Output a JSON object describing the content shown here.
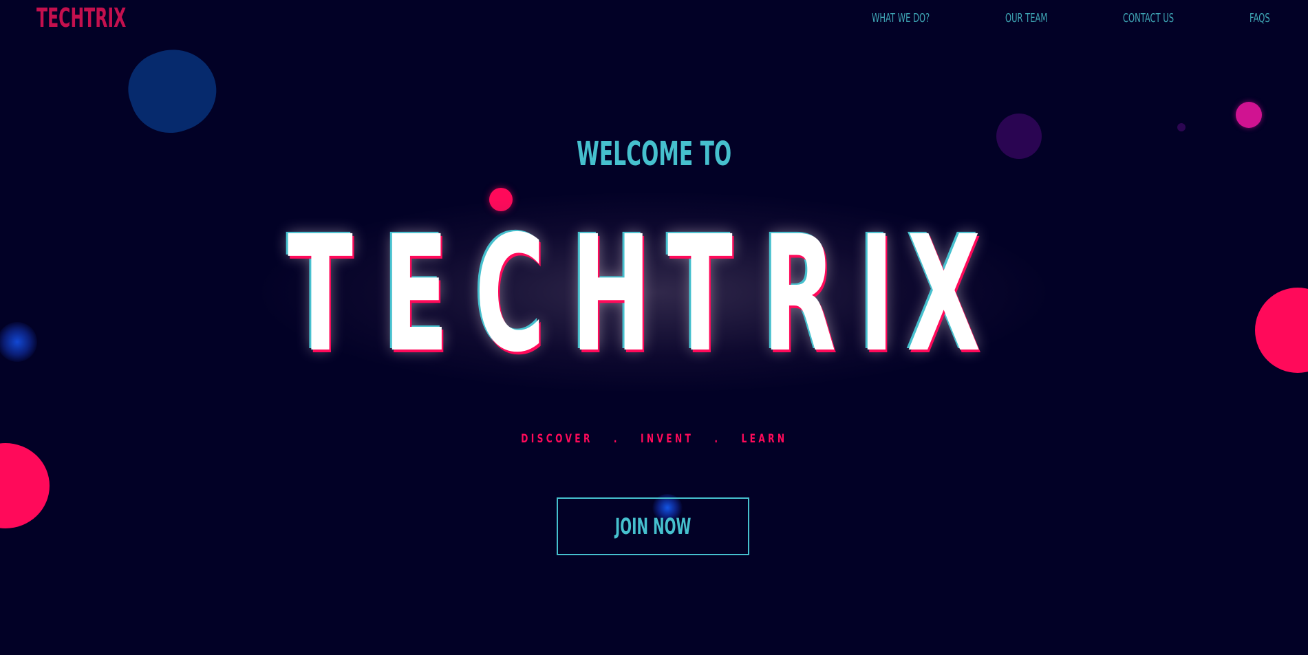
{
  "header": {
    "brand": "TECHTRIX",
    "nav": [
      {
        "label": "WHAT WE DO?"
      },
      {
        "label": "OUR TEAM"
      },
      {
        "label": "CONTACT US"
      },
      {
        "label": "FAQS"
      }
    ]
  },
  "hero": {
    "welcome": "WELCOME TO",
    "title_letters": [
      "T",
      "E",
      "C",
      "H",
      "T",
      "R",
      "I",
      "X"
    ],
    "tagline": [
      "DISCOVER",
      ".",
      "INVENT",
      ".",
      "LEARN"
    ],
    "cta_label": "JOIN NOW"
  },
  "colors": {
    "background": "#020126",
    "brand_pink": "#ff0a5a",
    "brand_cyan": "#46c0ce",
    "title_white": "#ffffff"
  }
}
